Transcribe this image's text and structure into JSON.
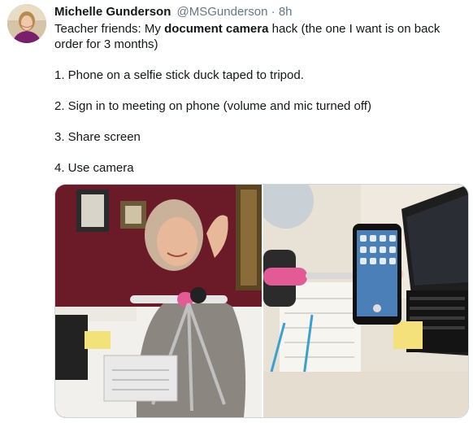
{
  "tweet": {
    "author_name": "Michelle Gunderson",
    "handle": "@MSGunderson",
    "separator": "·",
    "time": "8h",
    "intro_before": "Teacher friends: My ",
    "intro_bold": "document camera",
    "intro_after": " hack (the one I want is on back order for 3 months)",
    "steps": [
      "1. Phone on a selfie stick duck taped to tripod.",
      "2. Sign in to meeting on phone (volume and mic turned off)",
      "3. Share screen",
      "4. Use camera"
    ]
  },
  "colors": {
    "text": "#14171a",
    "secondary": "#657786",
    "border": "#ccd6dd"
  },
  "icons": {
    "avatar": "profile-photo",
    "photo1": "teacher-with-tripod-photo",
    "photo2": "phone-on-selfie-stick-photo"
  }
}
